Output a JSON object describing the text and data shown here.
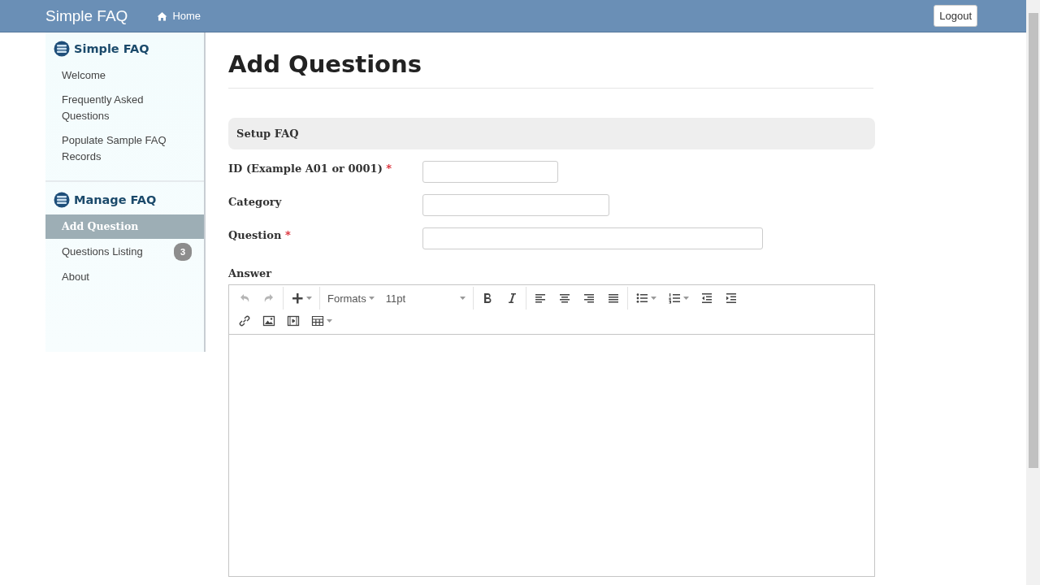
{
  "navbar": {
    "brand": "Simple FAQ",
    "home_link": "Home",
    "logout_button": "Logout"
  },
  "sidebar": {
    "sections": [
      {
        "title": "Simple FAQ",
        "items": [
          {
            "label": "Welcome",
            "selected": false
          },
          {
            "label": "Frequently Asked Questions",
            "selected": false
          },
          {
            "label": "Populate Sample FAQ Records",
            "selected": false
          }
        ]
      },
      {
        "title": "Manage FAQ",
        "items": [
          {
            "label": "Add Question",
            "selected": true
          },
          {
            "label": "Questions Listing",
            "selected": false,
            "badge": "3"
          },
          {
            "label": "About",
            "selected": false
          }
        ]
      }
    ]
  },
  "page": {
    "title": "Add Questions",
    "panel_title": "Setup FAQ",
    "fields": [
      {
        "label": "ID (Example A01 or 0001)",
        "required_mark": "*"
      },
      {
        "label": "Category"
      },
      {
        "label": "Question",
        "required_mark": "*"
      }
    ],
    "answer": {
      "label": "Answer",
      "toolbar": [
        {
          "kind": "undo",
          "disabled": true
        },
        {
          "kind": "redo",
          "disabled": true
        },
        {
          "kind": "sep"
        },
        {
          "kind": "insert"
        },
        {
          "kind": "sep"
        },
        {
          "kind": "formats",
          "label": "Formats"
        },
        {
          "kind": "fontsize",
          "label": "11pt"
        },
        {
          "kind": "sep"
        },
        {
          "kind": "bold"
        },
        {
          "kind": "italic"
        },
        {
          "kind": "sep"
        },
        {
          "kind": "align-left"
        },
        {
          "kind": "align-center"
        },
        {
          "kind": "align-right"
        },
        {
          "kind": "justify"
        },
        {
          "kind": "sep"
        },
        {
          "kind": "bullet-list"
        },
        {
          "kind": "numbered-list"
        },
        {
          "kind": "outdent"
        },
        {
          "kind": "indent"
        },
        {
          "kind": "break"
        },
        {
          "kind": "link"
        },
        {
          "kind": "image"
        },
        {
          "kind": "media"
        },
        {
          "kind": "table"
        }
      ]
    }
  }
}
